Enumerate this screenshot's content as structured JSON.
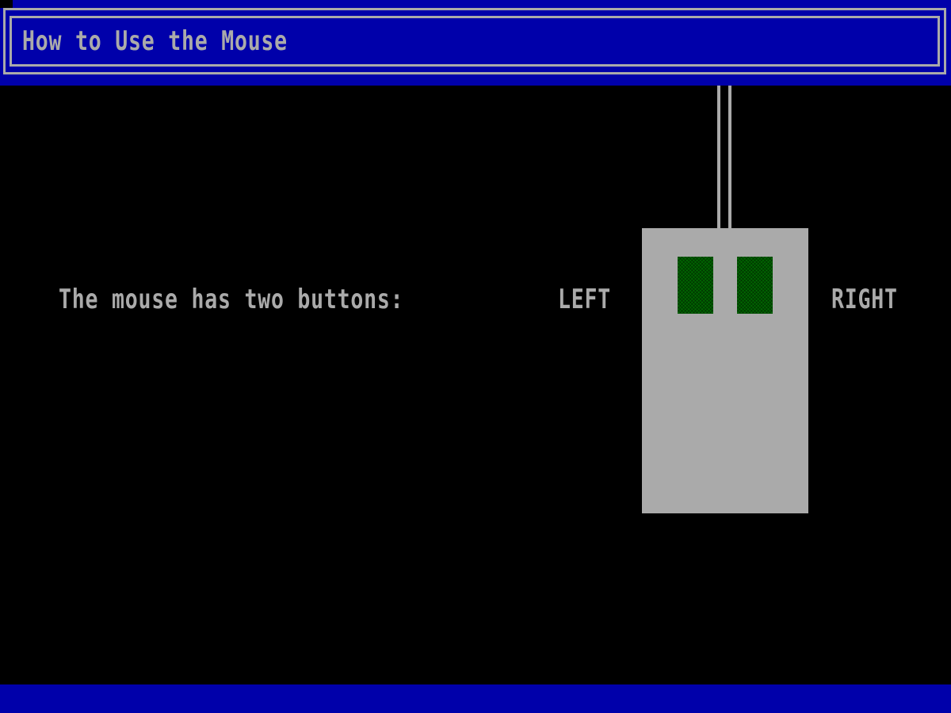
{
  "title_bar": {
    "title": "How to Use the Mouse"
  },
  "main": {
    "intro_text": "The mouse has two buttons:",
    "left_label": "LEFT",
    "right_label": "RIGHT"
  },
  "colors": {
    "title_bar_bg": "#0000aa",
    "bottom_bar_bg": "#0000aa",
    "background": "#000000",
    "text": "#aaaaaa",
    "mouse_body": "#aaaaaa",
    "mouse_buttons": "#006600"
  }
}
